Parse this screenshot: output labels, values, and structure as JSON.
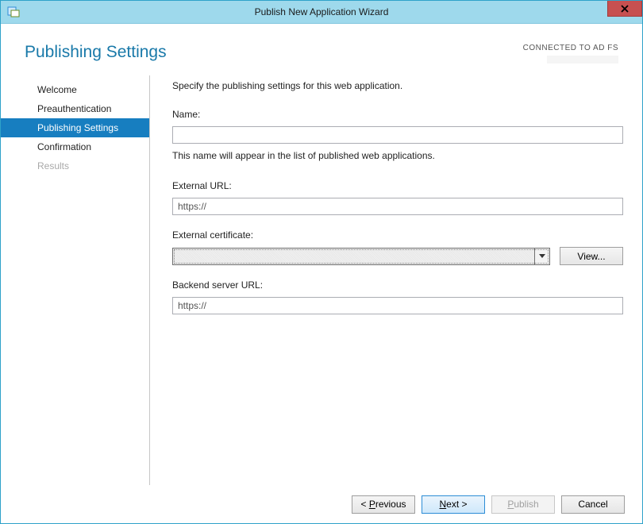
{
  "window": {
    "title": "Publish New Application Wizard"
  },
  "header": {
    "heading": "Publishing Settings",
    "connection_label": "CONNECTED TO AD FS"
  },
  "sidebar": {
    "steps": [
      {
        "label": "Welcome",
        "state": "done"
      },
      {
        "label": "Preauthentication",
        "state": "done"
      },
      {
        "label": "Publishing Settings",
        "state": "active"
      },
      {
        "label": "Confirmation",
        "state": "done"
      },
      {
        "label": "Results",
        "state": "disabled"
      }
    ]
  },
  "form": {
    "instruction": "Specify the publishing settings for this web application.",
    "name_label": "Name:",
    "name_value": "",
    "name_hint": "This name will appear in the list of published web applications.",
    "ext_url_label": "External URL:",
    "ext_url_value": "https://",
    "cert_label": "External certificate:",
    "cert_value": "",
    "view_label": "View...",
    "backend_label": "Backend server URL:",
    "backend_value": "https://"
  },
  "footer": {
    "previous": "< Previous",
    "next": "Next >",
    "publish": "Publish",
    "cancel": "Cancel"
  }
}
